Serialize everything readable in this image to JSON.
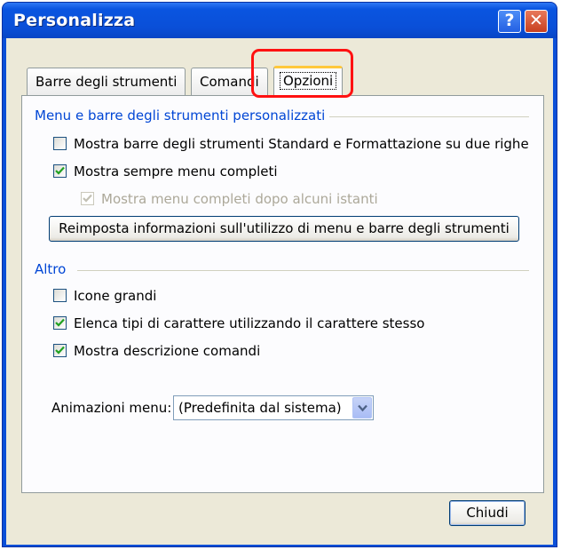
{
  "window": {
    "title": "Personalizza",
    "help_glyph": "?",
    "close_glyph": "✕"
  },
  "tabs": [
    {
      "label": "Barre degli strumenti"
    },
    {
      "label": "Comandi"
    },
    {
      "label": "Opzioni"
    }
  ],
  "group_menu": {
    "title": "Menu e barre degli strumenti personalizzati",
    "options": [
      {
        "label": "Mostra barre degli strumenti Standard e Formattazione su due righe",
        "checked": false,
        "enabled": true
      },
      {
        "label": "Mostra sempre menu completi",
        "checked": true,
        "enabled": true
      },
      {
        "label": "Mostra menu completi dopo alcuni istanti",
        "checked": true,
        "enabled": false
      }
    ],
    "reset_button": "Reimposta informazioni sull'utilizzo di menu e barre degli strumenti"
  },
  "group_other": {
    "title": "Altro",
    "options": [
      {
        "label": "Icone grandi",
        "checked": false,
        "enabled": true
      },
      {
        "label": "Elenca tipi di carattere utilizzando il carattere stesso",
        "checked": true,
        "enabled": true
      },
      {
        "label": "Mostra descrizione comandi",
        "checked": true,
        "enabled": true
      }
    ]
  },
  "animation": {
    "label": "Animazioni menu:",
    "value": "(Predefinita dal sistema)"
  },
  "close_button": "Chiudi",
  "colors": {
    "titlebar": "#0a4fd8",
    "group_title": "#0046d5",
    "check": "#21a121",
    "highlight": "#ff1111",
    "tab_active_accent": "#ffc83c"
  }
}
